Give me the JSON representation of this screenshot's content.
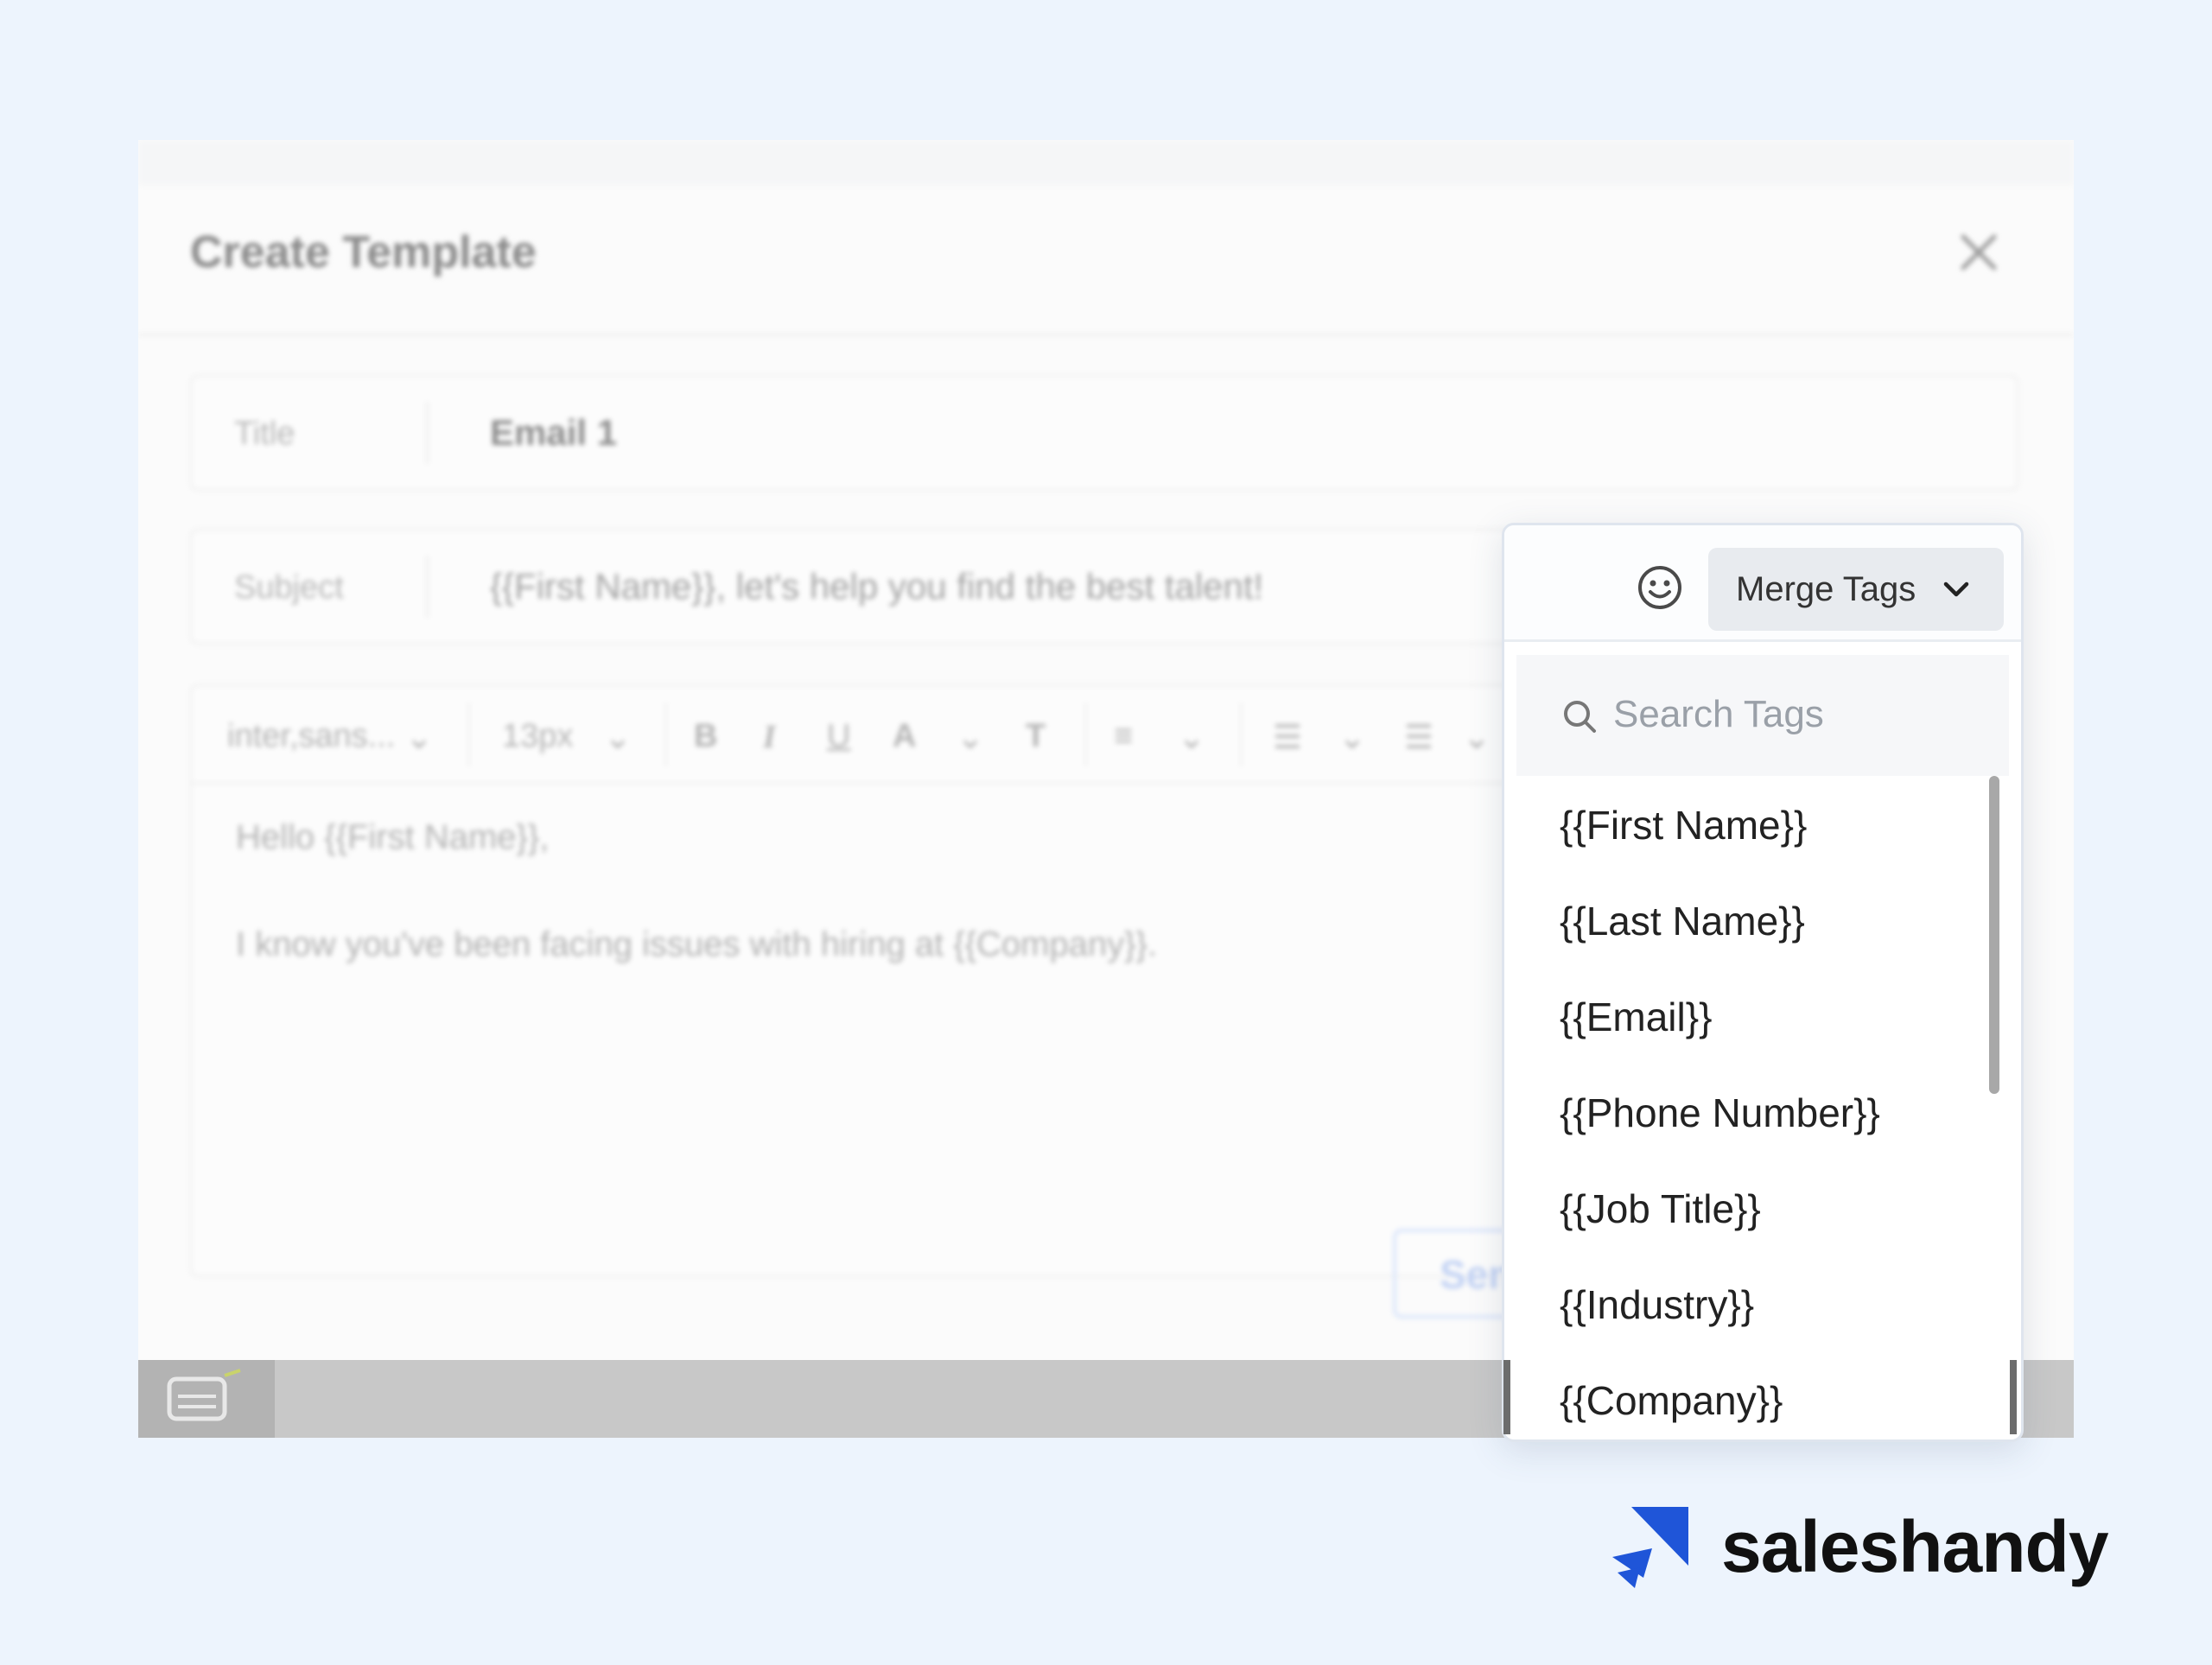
{
  "modal": {
    "title": "Create Template",
    "title_field": {
      "label": "Title",
      "value": "Email 1"
    },
    "subject_field": {
      "label": "Subject",
      "value": "{{First Name}}, let's help you find the best talent!"
    },
    "toolbar": {
      "font_family": "inter,sans...",
      "font_size": "13px"
    },
    "body": {
      "line1": "Hello {{First Name}},",
      "line2": "I know you've been facing issues with hiring at {{Company}}."
    },
    "send_button_label": "Sen"
  },
  "merge_tags": {
    "button_label": "Merge Tags",
    "search_placeholder": "Search Tags",
    "items": [
      "{{First Name}}",
      "{{Last Name}}",
      "{{Email}}",
      "{{Phone Number}}",
      "{{Job Title}}",
      "{{Industry}}",
      "{{Company}}"
    ]
  },
  "brand": {
    "name": "saleshandy",
    "accent_color": "#1f55d8"
  },
  "icons": [
    "close-icon",
    "smiley-icon",
    "chevron-down-icon",
    "search-icon",
    "saleshandy-logo-icon"
  ]
}
